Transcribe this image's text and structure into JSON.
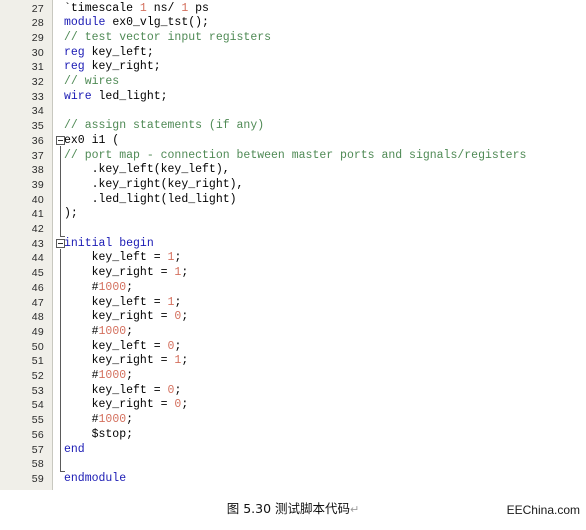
{
  "editor": {
    "first_line_number": 27,
    "language": "verilog",
    "colors": {
      "keyword": "#1a1ab4",
      "comment": "#4f8a55",
      "number": "#d4705e",
      "plain": "#000000",
      "gutter_background": "#f0efe9",
      "background": "#ffffff"
    },
    "lines": [
      {
        "no": "27",
        "segments": [
          {
            "t": "`timescale ",
            "c": "pl"
          },
          {
            "t": "1",
            "c": "num"
          },
          {
            "t": " ns/ ",
            "c": "pl"
          },
          {
            "t": "1",
            "c": "num"
          },
          {
            "t": " ps",
            "c": "pl"
          }
        ]
      },
      {
        "no": "28",
        "segments": [
          {
            "t": "module",
            "c": "kw"
          },
          {
            "t": " ex0_vlg_tst();",
            "c": "pl"
          }
        ]
      },
      {
        "no": "29",
        "segments": [
          {
            "t": "// test vector input registers",
            "c": "cm"
          }
        ]
      },
      {
        "no": "30",
        "segments": [
          {
            "t": "reg",
            "c": "kw"
          },
          {
            "t": " key_left;",
            "c": "pl"
          }
        ]
      },
      {
        "no": "31",
        "segments": [
          {
            "t": "reg",
            "c": "kw"
          },
          {
            "t": " key_right;",
            "c": "pl"
          }
        ]
      },
      {
        "no": "32",
        "segments": [
          {
            "t": "// wires",
            "c": "cm"
          }
        ]
      },
      {
        "no": "33",
        "segments": [
          {
            "t": "wire",
            "c": "kw"
          },
          {
            "t": " led_light;",
            "c": "pl"
          }
        ]
      },
      {
        "no": "34",
        "segments": []
      },
      {
        "no": "35",
        "segments": [
          {
            "t": "// assign statements (if any)",
            "c": "cm"
          }
        ]
      },
      {
        "no": "36",
        "segments": [
          {
            "t": "ex0 i1 (",
            "c": "pl"
          }
        ]
      },
      {
        "no": "37",
        "segments": [
          {
            "t": "// port map - connection between master ports and signals/registers",
            "c": "cm"
          }
        ]
      },
      {
        "no": "38",
        "segments": [
          {
            "t": "    .key_left(key_left),",
            "c": "pl"
          }
        ]
      },
      {
        "no": "39",
        "segments": [
          {
            "t": "    .key_right(key_right),",
            "c": "pl"
          }
        ]
      },
      {
        "no": "40",
        "segments": [
          {
            "t": "    .led_light(led_light)",
            "c": "pl"
          }
        ]
      },
      {
        "no": "41",
        "segments": [
          {
            "t": ");",
            "c": "pl"
          }
        ]
      },
      {
        "no": "42",
        "segments": []
      },
      {
        "no": "43",
        "segments": [
          {
            "t": "initial begin",
            "c": "kw"
          }
        ]
      },
      {
        "no": "44",
        "segments": [
          {
            "t": "    key_left = ",
            "c": "pl"
          },
          {
            "t": "1",
            "c": "num"
          },
          {
            "t": ";",
            "c": "pl"
          }
        ]
      },
      {
        "no": "45",
        "segments": [
          {
            "t": "    key_right = ",
            "c": "pl"
          },
          {
            "t": "1",
            "c": "num"
          },
          {
            "t": ";",
            "c": "pl"
          }
        ]
      },
      {
        "no": "46",
        "segments": [
          {
            "t": "    #",
            "c": "pl"
          },
          {
            "t": "1000",
            "c": "num"
          },
          {
            "t": ";",
            "c": "pl"
          }
        ]
      },
      {
        "no": "47",
        "segments": [
          {
            "t": "    key_left = ",
            "c": "pl"
          },
          {
            "t": "1",
            "c": "num"
          },
          {
            "t": ";",
            "c": "pl"
          }
        ]
      },
      {
        "no": "48",
        "segments": [
          {
            "t": "    key_right = ",
            "c": "pl"
          },
          {
            "t": "0",
            "c": "num"
          },
          {
            "t": ";",
            "c": "pl"
          }
        ]
      },
      {
        "no": "49",
        "segments": [
          {
            "t": "    #",
            "c": "pl"
          },
          {
            "t": "1000",
            "c": "num"
          },
          {
            "t": ";",
            "c": "pl"
          }
        ]
      },
      {
        "no": "50",
        "segments": [
          {
            "t": "    key_left = ",
            "c": "pl"
          },
          {
            "t": "0",
            "c": "num"
          },
          {
            "t": ";",
            "c": "pl"
          }
        ]
      },
      {
        "no": "51",
        "segments": [
          {
            "t": "    key_right = ",
            "c": "pl"
          },
          {
            "t": "1",
            "c": "num"
          },
          {
            "t": ";",
            "c": "pl"
          }
        ]
      },
      {
        "no": "52",
        "segments": [
          {
            "t": "    #",
            "c": "pl"
          },
          {
            "t": "1000",
            "c": "num"
          },
          {
            "t": ";",
            "c": "pl"
          }
        ]
      },
      {
        "no": "53",
        "segments": [
          {
            "t": "    key_left = ",
            "c": "pl"
          },
          {
            "t": "0",
            "c": "num"
          },
          {
            "t": ";",
            "c": "pl"
          }
        ]
      },
      {
        "no": "54",
        "segments": [
          {
            "t": "    key_right = ",
            "c": "pl"
          },
          {
            "t": "0",
            "c": "num"
          },
          {
            "t": ";",
            "c": "pl"
          }
        ]
      },
      {
        "no": "55",
        "segments": [
          {
            "t": "    #",
            "c": "pl"
          },
          {
            "t": "1000",
            "c": "num"
          },
          {
            "t": ";",
            "c": "pl"
          }
        ]
      },
      {
        "no": "56",
        "segments": [
          {
            "t": "    $stop;",
            "c": "pl"
          }
        ]
      },
      {
        "no": "57",
        "segments": [
          {
            "t": "end",
            "c": "kw"
          }
        ]
      },
      {
        "no": "58",
        "segments": []
      },
      {
        "no": "59",
        "segments": [
          {
            "t": "endmodule",
            "c": "kw"
          }
        ]
      }
    ],
    "fold_regions": [
      {
        "name": "module-instantiation-fold",
        "start_line": "36",
        "end_line": "41",
        "state": "expanded",
        "marker": "minus"
      },
      {
        "name": "initial-block-fold",
        "start_line": "43",
        "end_line": "57",
        "state": "expanded",
        "marker": "minus"
      }
    ]
  },
  "caption": {
    "text": "图 5.30 测试脚本代码",
    "paragraph_mark": "↵"
  },
  "footer": {
    "brand": "EEChina.com"
  }
}
